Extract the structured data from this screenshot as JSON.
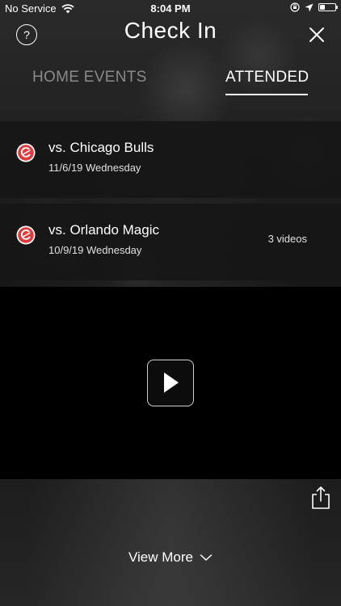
{
  "status_bar": {
    "carrier": "No Service",
    "time": "8:04 PM"
  },
  "header": {
    "title": "Check In",
    "help_label": "?"
  },
  "tabs": [
    {
      "label": "HOME EVENTS",
      "active": false
    },
    {
      "label": "ATTENDED",
      "active": true
    }
  ],
  "events": [
    {
      "title": "vs. Chicago Bulls",
      "date": "11/6/19 Wednesday",
      "videos": ""
    },
    {
      "title": "vs. Orlando Magic",
      "date": "10/9/19 Wednesday",
      "videos": "3 videos"
    }
  ],
  "footer": {
    "view_more_label": "View More"
  },
  "colors": {
    "accent_red": "#e03a3e",
    "inactive_tab": "#8a8a8a"
  }
}
